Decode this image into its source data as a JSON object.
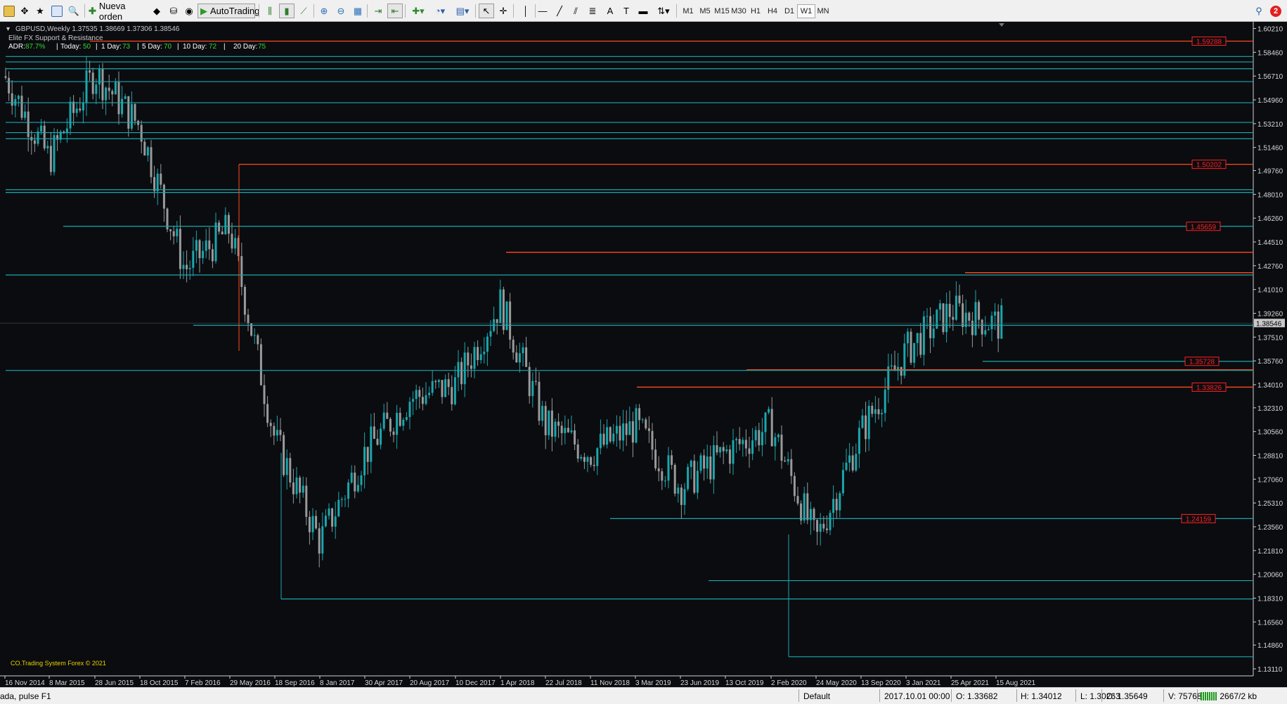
{
  "toolbar": {
    "new_order_label": "Nueva orden",
    "autotrading_label": "AutoTrading",
    "notification_count": "2",
    "timeframes": [
      "M1",
      "M5",
      "M15",
      "M30",
      "H1",
      "H4",
      "D1",
      "W1",
      "MN"
    ],
    "active_timeframe": "W1"
  },
  "chart": {
    "symbol_header": "GBPUSD,Weekly  1.37535 1.38669 1.37306 1.38546",
    "indicator_name": "Elite FX Support & Resistance",
    "adr_label": "ADR:",
    "adr_value": "87.7%",
    "today_label": "Today:",
    "today_value": "50",
    "day1_label": "1 Day:",
    "day1_value": "73",
    "day5_label": "5 Day:",
    "day5_value": "70",
    "day10_label": "10 Day:",
    "day10_value": "72",
    "day20_label": "20 Day:",
    "day20_value": "75",
    "watermark": "CO.Trading System Forex © 2021",
    "current_price": "1.38546",
    "colors": {
      "background": "#0b0c10",
      "support": "#1aa7ac",
      "resistance": "#ff4a1c",
      "candle_up": "#1aa7ac",
      "candle_down": "#9a9a9a",
      "label_red": "#ff2020",
      "yellow": "#e6d200",
      "green": "#2fd62f"
    }
  },
  "chart_data": {
    "type": "candlestick",
    "symbol": "GBPUSD",
    "timeframe": "Weekly",
    "ylim": [
      1.1218,
      1.6161
    ],
    "y_ticks": [
      "1.60210",
      "1.58460",
      "1.56710",
      "1.54960",
      "1.53210",
      "1.51460",
      "1.49760",
      "1.48010",
      "1.46260",
      "1.44510",
      "1.42760",
      "1.41010",
      "1.39260",
      "1.37510",
      "1.35760",
      "1.34010",
      "1.32310",
      "1.30560",
      "1.28810",
      "1.27060",
      "1.25310",
      "1.23560",
      "1.21810",
      "1.20060",
      "1.18310",
      "1.16560",
      "1.14860",
      "1.13110"
    ],
    "x_ticks": [
      "16 Nov 2014",
      "8 Mar 2015",
      "28 Jun 2015",
      "18 Oct 2015",
      "7 Feb 2016",
      "29 May 2016",
      "18 Sep 2016",
      "8 Jan 2017",
      "30 Apr 2017",
      "20 Aug 2017",
      "10 Dec 2017",
      "1 Apr 2018",
      "22 Jul 2018",
      "11 Nov 2018",
      "3 Mar 2019",
      "23 Jun 2019",
      "13 Oct 2019",
      "2 Feb 2020",
      "24 May 2020",
      "13 Sep 2020",
      "3 Jan 2021",
      "25 Apr 2021",
      "15 Aug 2021"
    ],
    "price_path": [
      {
        "date": "16 Nov 2014",
        "close": 1.567
      },
      {
        "date": "8 Mar 2015",
        "close": 1.506
      },
      {
        "date": "28 Jun 2015",
        "close": 1.57
      },
      {
        "date": "18 Oct 2015",
        "close": 1.53
      },
      {
        "date": "7 Feb 2016",
        "close": 1.425
      },
      {
        "date": "29 May 2016",
        "close": 1.455
      },
      {
        "date": "18 Sep 2016",
        "close": 1.3
      },
      {
        "date": "8 Jan 2017",
        "close": 1.225
      },
      {
        "date": "30 Apr 2017",
        "close": 1.29
      },
      {
        "date": "20 Aug 2017",
        "close": 1.33
      },
      {
        "date": "10 Dec 2017",
        "close": 1.34
      },
      {
        "date": "1 Apr 2018",
        "close": 1.4
      },
      {
        "date": "22 Jul 2018",
        "close": 1.31
      },
      {
        "date": "11 Nov 2018",
        "close": 1.29
      },
      {
        "date": "3 Mar 2019",
        "close": 1.31
      },
      {
        "date": "23 Jun 2019",
        "close": 1.265
      },
      {
        "date": "13 Oct 2019",
        "close": 1.29
      },
      {
        "date": "2 Feb 2020",
        "close": 1.31
      },
      {
        "date": "24 May 2020",
        "close": 1.225
      },
      {
        "date": "13 Sep 2020",
        "close": 1.305
      },
      {
        "date": "3 Jan 2021",
        "close": 1.365
      },
      {
        "date": "25 Apr 2021",
        "close": 1.395
      },
      {
        "date": "15 Aug 2021",
        "close": 1.385
      }
    ],
    "levels": [
      {
        "price": 1.5928,
        "kind": "resistance",
        "label": "1.59288"
      },
      {
        "price": 1.5022,
        "kind": "resistance",
        "label": "1.50202"
      },
      {
        "price": 1.4566,
        "kind": "support",
        "label": "1.45659"
      },
      {
        "price": 1.4375,
        "kind": "resistance",
        "label": ""
      },
      {
        "price": 1.4225,
        "kind": "resistance",
        "label": ""
      },
      {
        "price": 1.4208,
        "kind": "support",
        "label": ""
      },
      {
        "price": 1.3838,
        "kind": "support",
        "label": ""
      },
      {
        "price": 1.3573,
        "kind": "support",
        "label": "1.35728"
      },
      {
        "price": 1.3511,
        "kind": "resistance",
        "label": ""
      },
      {
        "price": 1.3506,
        "kind": "support",
        "label": ""
      },
      {
        "price": 1.3383,
        "kind": "resistance",
        "label": "1.33826"
      },
      {
        "price": 1.2416,
        "kind": "support",
        "label": "1.24159"
      },
      {
        "price": 1.196,
        "kind": "support",
        "label": ""
      },
      {
        "price": 1.1825,
        "kind": "support",
        "label": ""
      },
      {
        "price": 1.14,
        "kind": "support",
        "label": ""
      },
      {
        "price": 1.5815,
        "kind": "support",
        "label": ""
      },
      {
        "price": 1.5775,
        "kind": "support",
        "label": ""
      },
      {
        "price": 1.5725,
        "kind": "support",
        "label": ""
      },
      {
        "price": 1.563,
        "kind": "support",
        "label": ""
      },
      {
        "price": 1.5475,
        "kind": "support",
        "label": ""
      },
      {
        "price": 1.533,
        "kind": "support",
        "label": ""
      },
      {
        "price": 1.5255,
        "kind": "support",
        "label": ""
      },
      {
        "price": 1.521,
        "kind": "support",
        "label": ""
      },
      {
        "price": 1.4835,
        "kind": "support",
        "label": ""
      },
      {
        "price": 1.4815,
        "kind": "support",
        "label": ""
      }
    ]
  },
  "statusbar": {
    "help_text": "ada, pulse F1",
    "profile": "Default",
    "datetime": "2017.10.01 00:00",
    "open": "O: 1.33682",
    "high": "H: 1.34012",
    "low": "L: 1.30263",
    "close": "C: 1.35649",
    "volume": "V: 757682",
    "traffic": "2667/2 kb"
  }
}
